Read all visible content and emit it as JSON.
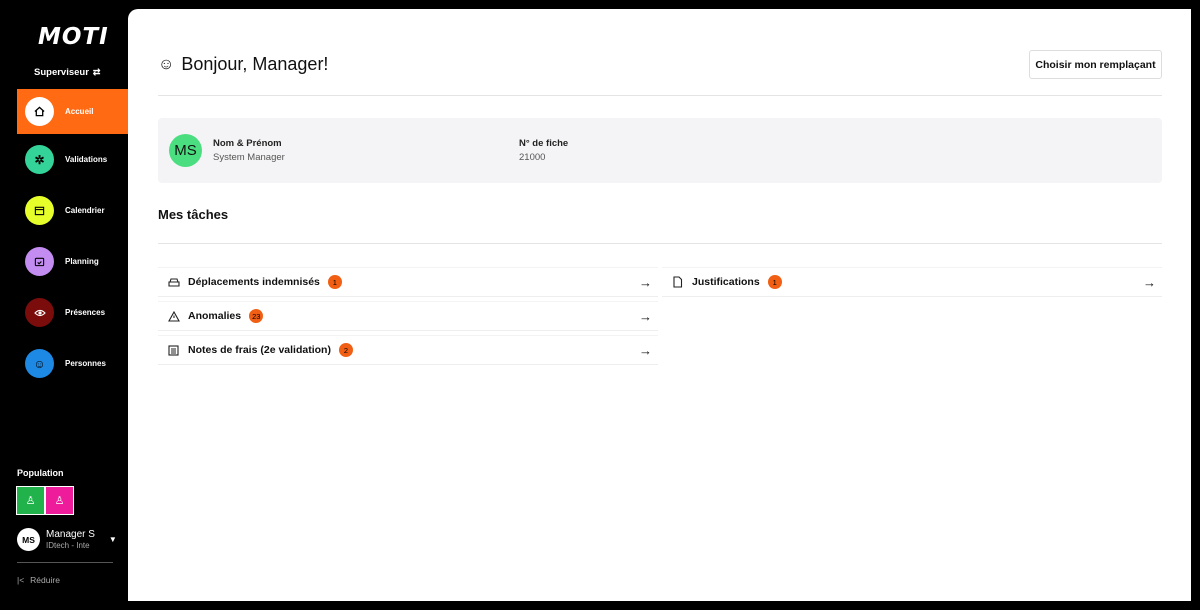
{
  "sidebar": {
    "logo": "MOTI",
    "role": "Superviseur",
    "items": [
      {
        "label": "Accueil",
        "icon": "home-icon",
        "color": "#ffffff"
      },
      {
        "label": "Validations",
        "icon": "asterisk-icon",
        "color": "#34d399"
      },
      {
        "label": "Calendrier",
        "icon": "calendar-icon",
        "color": "#e6ff2b"
      },
      {
        "label": "Planning",
        "icon": "planning-icon",
        "color": "#c28cf0"
      },
      {
        "label": "Présences",
        "icon": "eye-icon",
        "color": "#7a0c0c"
      },
      {
        "label": "Personnes",
        "icon": "face-icon",
        "color": "#1e88e5"
      }
    ],
    "active_color": "#ff6a13",
    "population_label": "Population",
    "population_colors": [
      "#22b24c",
      "#ee1b9b"
    ],
    "user": {
      "initials": "MS",
      "name": "Manager S",
      "org": "IDtech - Inte"
    },
    "reduce_label": "Réduire"
  },
  "header": {
    "greeting": "Bonjour, Manager!",
    "replace_button": "Choisir mon remplaçant"
  },
  "profile": {
    "initials": "MS",
    "name_label": "Nom & Prénom",
    "name_value": "System Manager",
    "file_label": "N° de fiche",
    "file_value": "21000"
  },
  "tasks": {
    "title": "Mes tâches",
    "items": [
      {
        "label": "Déplacements indemnisés",
        "count": "1",
        "icon": "car-icon"
      },
      {
        "label": "Justifications",
        "count": "1",
        "icon": "document-icon"
      },
      {
        "label": "Anomalies",
        "count": "23",
        "icon": "warning-icon"
      },
      {
        "label": "Notes de frais (2e validation)",
        "count": "2",
        "icon": "list-icon"
      }
    ]
  }
}
